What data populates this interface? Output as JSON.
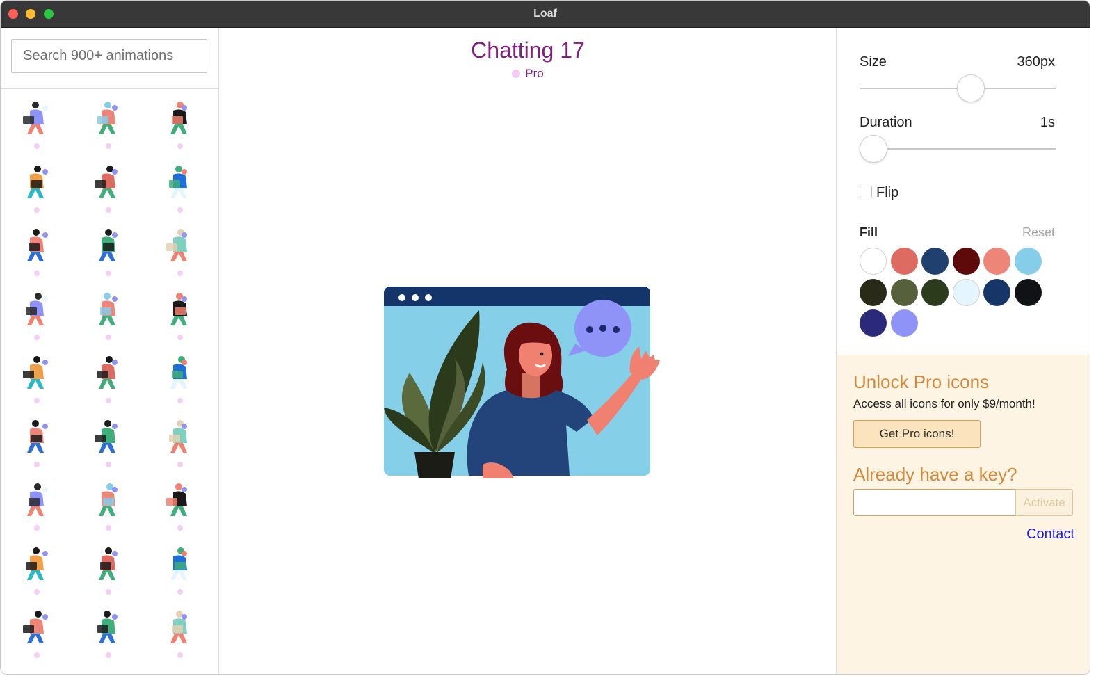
{
  "window": {
    "title": "Loaf"
  },
  "sidebar": {
    "search_placeholder": "Search 900+ animations",
    "thumbnails": [
      {
        "name": "person-laptop"
      },
      {
        "name": "person-reading"
      },
      {
        "name": "person-standing"
      },
      {
        "name": "person-phone"
      },
      {
        "name": "person-chair"
      },
      {
        "name": "person-sitting"
      },
      {
        "name": "person-desk"
      },
      {
        "name": "person-computer"
      },
      {
        "name": "person-workstation"
      },
      {
        "name": "person-laptop-2"
      },
      {
        "name": "person-walking"
      },
      {
        "name": "person-floor"
      },
      {
        "name": "video-call"
      },
      {
        "name": "person-lying"
      },
      {
        "name": "person-lying-2"
      },
      {
        "name": "person-reclining"
      },
      {
        "name": "person-chat"
      },
      {
        "name": "person-waving"
      },
      {
        "name": "person-jumping"
      },
      {
        "name": "person-dancing"
      },
      {
        "name": "person-laptop-3"
      },
      {
        "name": "person-reading-2"
      },
      {
        "name": "person-standing-2"
      },
      {
        "name": "person-phone-2"
      },
      {
        "name": "person-chair-2"
      },
      {
        "name": "person-sitting-2"
      },
      {
        "name": "person-desk-2"
      }
    ]
  },
  "main": {
    "title": "Chatting 17",
    "badge": "Pro",
    "colors": {
      "title": "#7e1f7e",
      "badge_dot": "#f3cbf3"
    }
  },
  "controls": {
    "size": {
      "label": "Size",
      "value": "360px",
      "level": 0.58
    },
    "duration": {
      "label": "Duration",
      "value": "1s",
      "level": 0.0
    },
    "flip": {
      "label": "Flip",
      "checked": false
    },
    "fill": {
      "label": "Fill",
      "reset": "Reset",
      "swatches": [
        "#ffffff",
        "#dd6b61",
        "#20416f",
        "#5e0a0a",
        "#ed8679",
        "#86cdea",
        "#2a2a18",
        "#56603a",
        "#2c3b1c",
        "#e4f5fd",
        "#163668",
        "#111215",
        "#2b2a7a",
        "#8f93f7"
      ]
    }
  },
  "promo": {
    "title": "Unlock Pro icons",
    "text": "Access all icons for only $9/month!",
    "button": "Get Pro icons!",
    "key_title": "Already have a key?",
    "key_placeholder": "",
    "activate": "Activate",
    "contact": "Contact",
    "accent": "#d38a3e"
  }
}
